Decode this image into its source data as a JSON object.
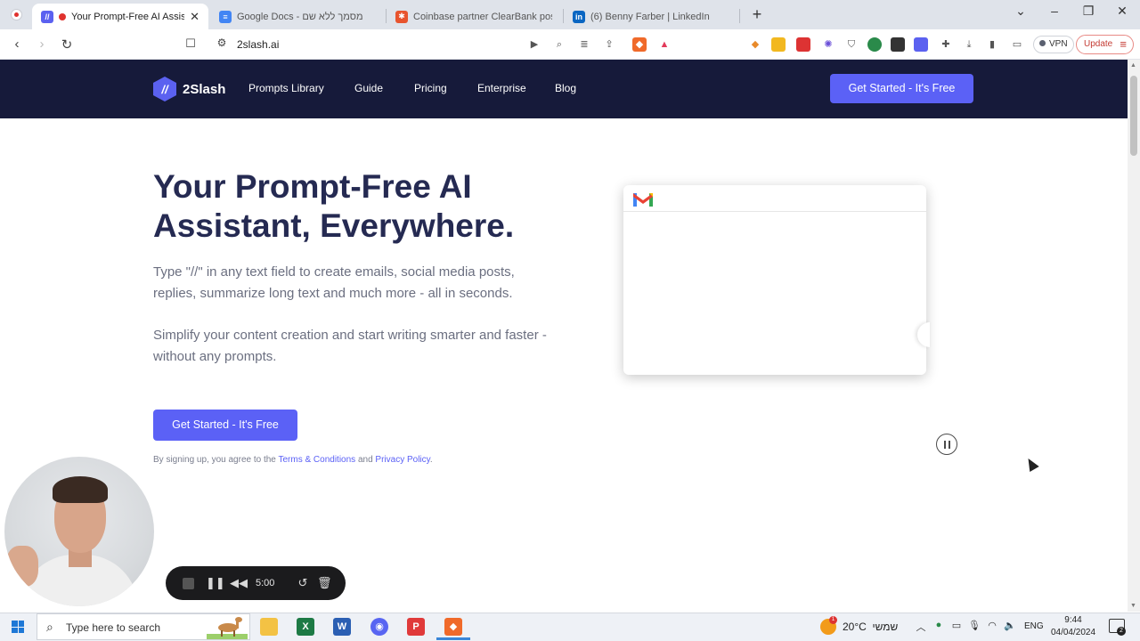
{
  "browser": {
    "tabs": [
      {
        "title": "Your Prompt-Free AI Assistant",
        "favicon": "2slash-icon",
        "color": "#5b61f0",
        "active": true
      },
      {
        "title": "Google Docs - מסמך ללא שם",
        "favicon": "google-docs-icon",
        "color": "#4285f4",
        "active": false
      },
      {
        "title": "Coinbase partner ClearBank posts fir",
        "favicon": "nbc-icon",
        "color": "#e8542e",
        "active": false
      },
      {
        "title": "(6) Benny Farber | LinkedIn",
        "favicon": "linkedin-icon",
        "color": "#0a66c2",
        "active": false
      }
    ],
    "url": "2slash.ai",
    "vpn_label": "VPN",
    "update_label": "Update"
  },
  "site": {
    "logo_text": "2Slash",
    "nav": [
      "Prompts  Library",
      "Guide",
      "Pricing",
      "Enterprise",
      "Blog"
    ],
    "header_cta": "Get Started - It's Free",
    "hero_title": "Your Prompt-Free AI Assistant, Everywhere.",
    "hero_p1": "Type \"//\" in any text field to create emails, social media posts, replies, summarize long text and much more - all in seconds.",
    "hero_p2": "Simplify your content creation and start writing smarter and faster - without any prompts.",
    "hero_cta": "Get Started - It's Free",
    "legal_prefix": "By signing up, you agree to the ",
    "legal_terms": "Terms & Conditions",
    "legal_and": " and ",
    "legal_privacy": "Privacy Policy",
    "legal_suffix": ".",
    "accent_color": "#5b61f6",
    "header_bg": "#161a3a"
  },
  "recorder": {
    "time": "5:00"
  },
  "taskbar": {
    "search_placeholder": "Type here to search",
    "weather_temp": "20°C",
    "weather_day": "שמשי",
    "weather_badge": "1",
    "language": "ENG",
    "time": "9:44",
    "date": "04/04/2024",
    "notifications": "2"
  }
}
